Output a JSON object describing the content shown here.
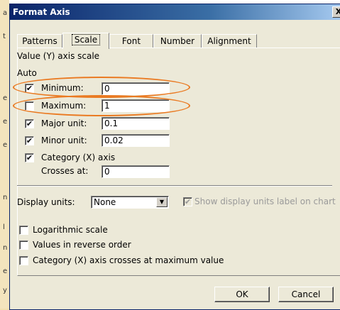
{
  "background": {
    "letters": [
      "a",
      "t",
      "e",
      "e",
      "e",
      "n",
      "l",
      "n",
      "e",
      "y"
    ]
  },
  "dialog": {
    "title": "Format Axis",
    "close_label": "X",
    "tabs": [
      {
        "label": "Patterns"
      },
      {
        "label": "Scale",
        "active": true
      },
      {
        "label": "Font"
      },
      {
        "label": "Number"
      },
      {
        "label": "Alignment"
      }
    ],
    "section_title": "Value (Y) axis scale",
    "auto_label": "Auto",
    "fields": {
      "minimum": {
        "label": "Minimum:",
        "checked": true,
        "value": "0"
      },
      "maximum": {
        "label": "Maximum:",
        "checked": false,
        "value": "1"
      },
      "major_unit": {
        "label": "Major unit:",
        "checked": true,
        "value": "0.1"
      },
      "minor_unit": {
        "label": "Minor unit:",
        "checked": true,
        "value": "0.02"
      },
      "category_axis": {
        "label": "Category (X) axis",
        "checked": true
      },
      "crosses_at": {
        "label": "Crosses at:",
        "value": "0"
      }
    },
    "display_units": {
      "label": "Display units:",
      "value": "None",
      "show_label": "Show display units label on chart"
    },
    "options": {
      "logarithmic": "Logarithmic scale",
      "reverse": "Values in reverse order",
      "crosses_max": "Category (X) axis crosses at maximum value"
    },
    "buttons": {
      "ok": "OK",
      "cancel": "Cancel"
    },
    "highlight_color": "#ea7a22",
    "check_mark": "✔"
  }
}
